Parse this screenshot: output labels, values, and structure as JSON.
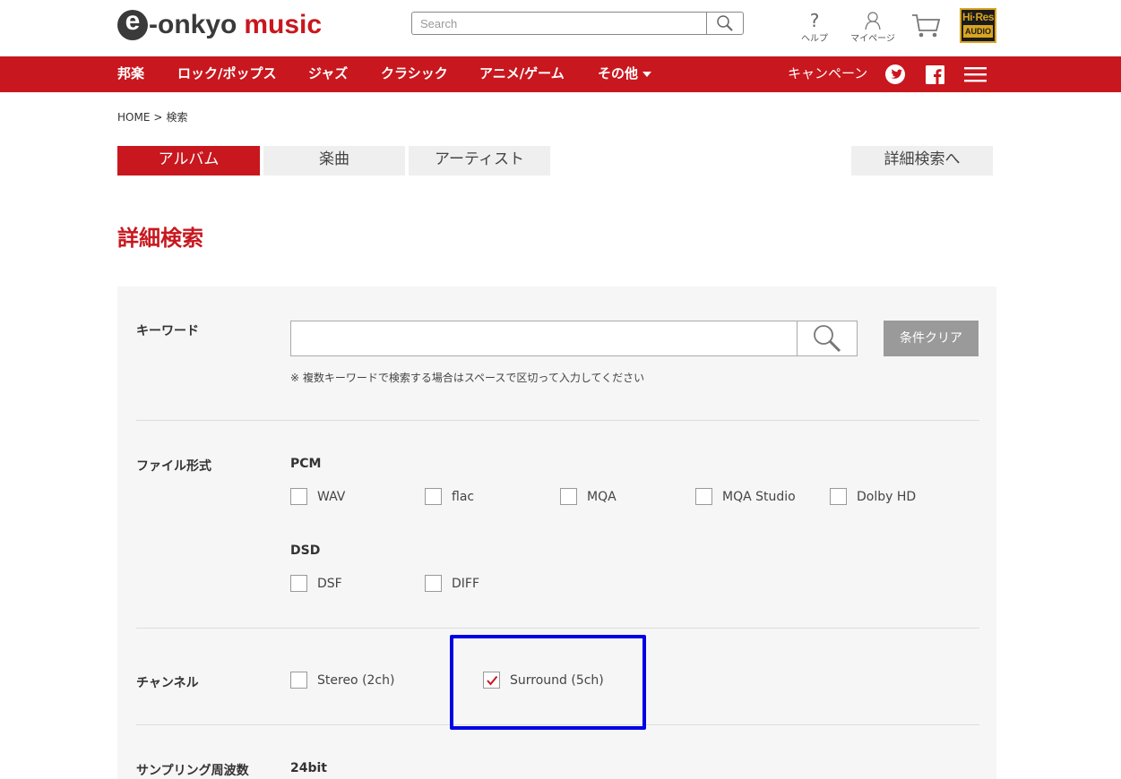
{
  "header": {
    "logo": {
      "e": "e",
      "dash": "-",
      "onkyo": "onkyo",
      "music": "music"
    },
    "search_placeholder": "Search",
    "help_label": "ヘルプ",
    "mypage_label": "マイページ",
    "hires": {
      "line1": "Hi·Res",
      "line2": "AUDIO"
    }
  },
  "nav": {
    "items": [
      "邦楽",
      "ロック/ポップス",
      "ジャズ",
      "クラシック",
      "アニメ/ゲーム",
      "その他"
    ],
    "campaign": "キャンペーン"
  },
  "breadcrumb": {
    "home": "HOME",
    "sep": ">",
    "current": "検索"
  },
  "tabs": {
    "album": "アルバム",
    "track": "楽曲",
    "artist": "アーティスト",
    "advanced": "詳細検索へ"
  },
  "title": "詳細検索",
  "keyword": {
    "label": "キーワード",
    "value": "",
    "clear": "条件クリア",
    "note": "※ 複数キーワードで検索する場合はスペースで区切って入力してください"
  },
  "file_format": {
    "label": "ファイル形式",
    "pcm_label": "PCM",
    "pcm": [
      {
        "label": "WAV",
        "checked": false
      },
      {
        "label": "flac",
        "checked": false
      },
      {
        "label": "MQA",
        "checked": false
      },
      {
        "label": "MQA Studio",
        "checked": false
      },
      {
        "label": "Dolby HD",
        "checked": false
      }
    ],
    "dsd_label": "DSD",
    "dsd": [
      {
        "label": "DSF",
        "checked": false
      },
      {
        "label": "DIFF",
        "checked": false
      }
    ]
  },
  "channel": {
    "label": "チャンネル",
    "options": [
      {
        "label": "Stereo (2ch)",
        "checked": false
      },
      {
        "label": "Surround (5ch)",
        "checked": true
      }
    ]
  },
  "sampling": {
    "label": "サンプリング周波数",
    "bit_label": "24bit"
  },
  "colors": {
    "brand_red": "#c8171e",
    "highlight": "#0000e6",
    "panel_bg": "#f6f6f6"
  }
}
